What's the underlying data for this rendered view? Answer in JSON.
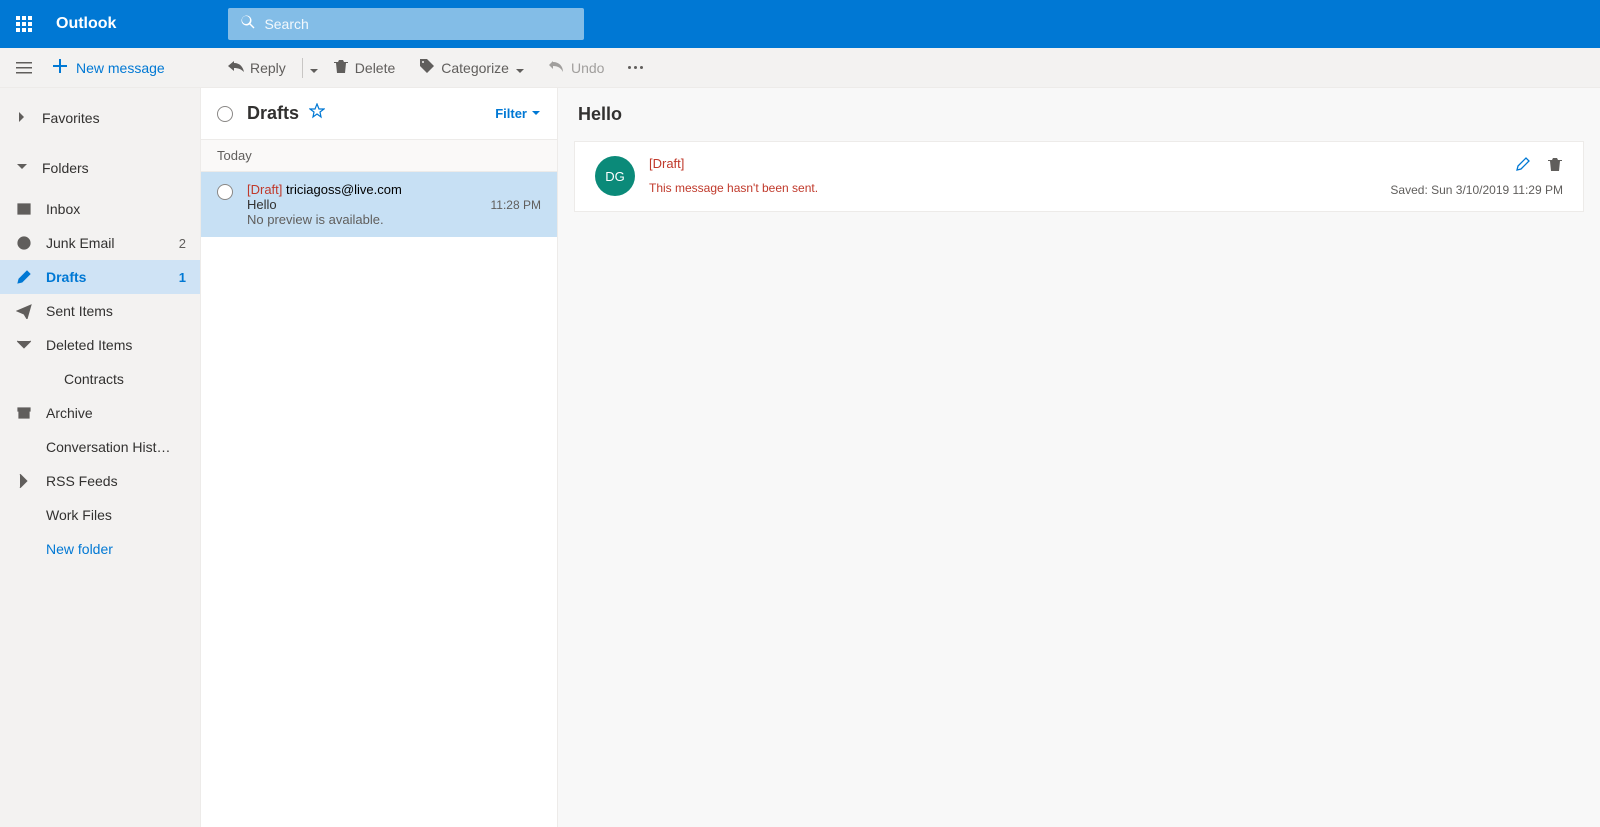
{
  "brand": "Outlook",
  "search": {
    "placeholder": "Search"
  },
  "toolbar": {
    "new_message": "New message",
    "reply": "Reply",
    "delete": "Delete",
    "categorize": "Categorize",
    "undo": "Undo"
  },
  "sidebar": {
    "favorites": "Favorites",
    "folders": "Folders",
    "items": [
      {
        "label": "Inbox",
        "count": ""
      },
      {
        "label": "Junk Email",
        "count": "2"
      },
      {
        "label": "Drafts",
        "count": "1"
      },
      {
        "label": "Sent Items",
        "count": ""
      },
      {
        "label": "Deleted Items",
        "count": ""
      },
      {
        "label": "Contracts",
        "count": ""
      },
      {
        "label": "Archive",
        "count": ""
      },
      {
        "label": "Conversation Hist…",
        "count": ""
      },
      {
        "label": "RSS Feeds",
        "count": ""
      },
      {
        "label": "Work Files",
        "count": ""
      }
    ],
    "new_folder": "New folder"
  },
  "list": {
    "title": "Drafts",
    "filter": "Filter",
    "group": "Today",
    "item": {
      "tag": "[Draft]",
      "to": "triciagoss@live.com",
      "subject": "Hello",
      "time": "11:28 PM",
      "preview": "No preview is available."
    }
  },
  "reading": {
    "subject": "Hello",
    "avatar": "DG",
    "tag": "[Draft]",
    "unsent": "This message hasn't been sent.",
    "saved": "Saved: Sun 3/10/2019 11:29 PM"
  }
}
